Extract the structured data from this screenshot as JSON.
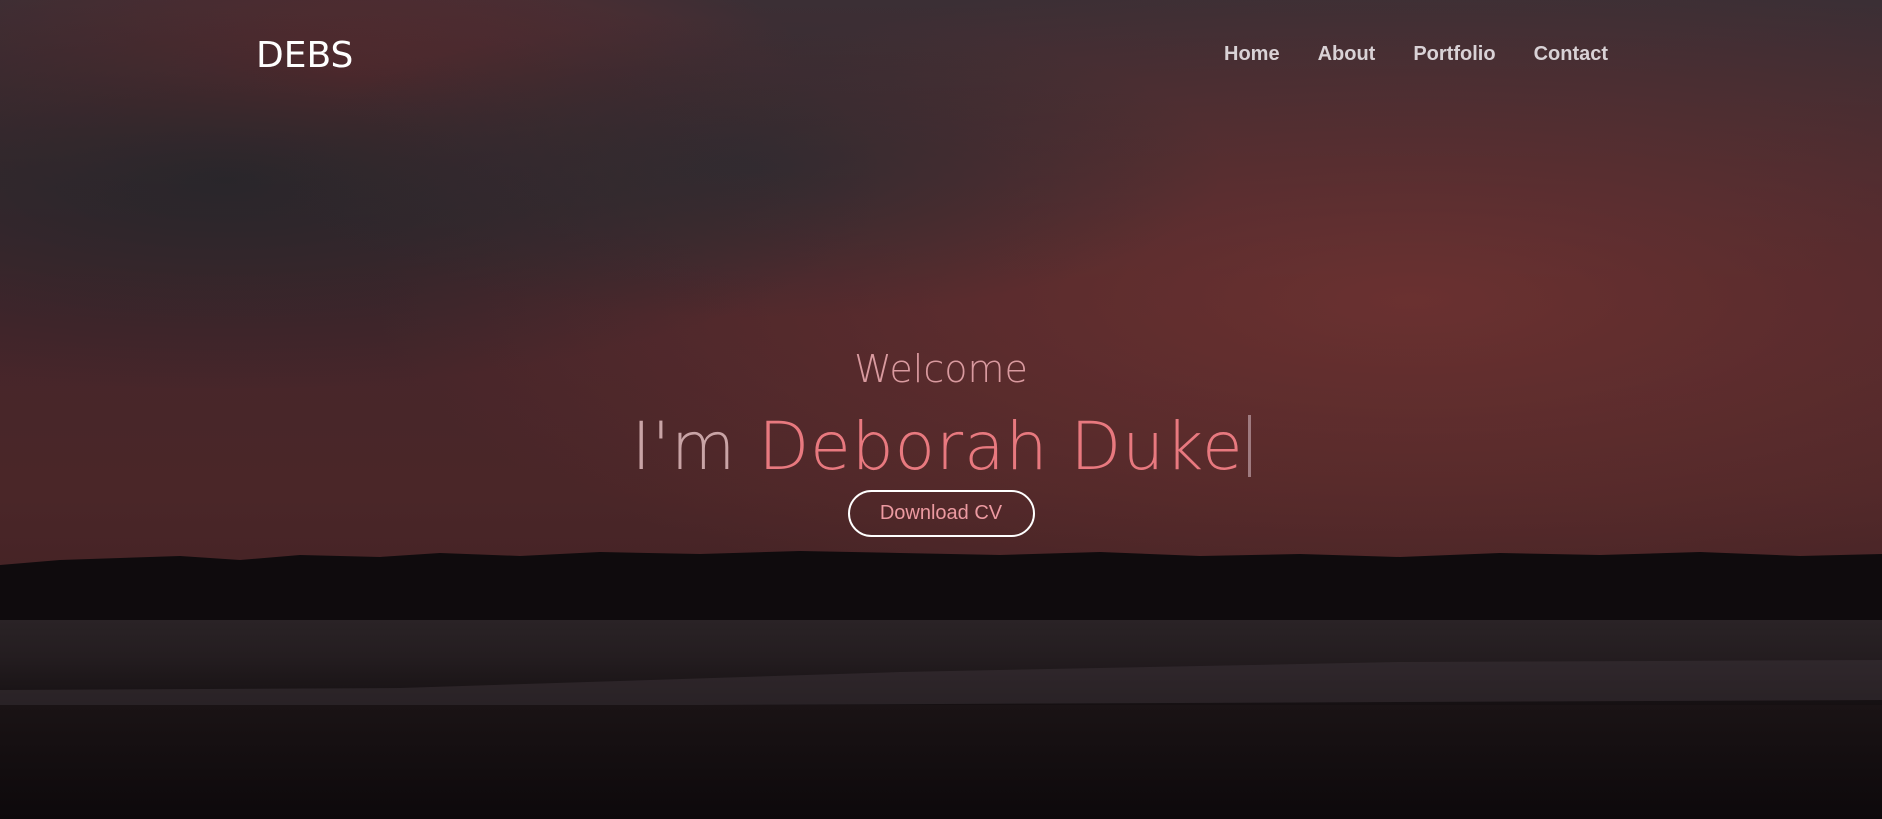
{
  "header": {
    "brand": "DEBS",
    "nav": [
      {
        "label": "Home"
      },
      {
        "label": "About"
      },
      {
        "label": "Portfolio"
      },
      {
        "label": "Contact"
      }
    ]
  },
  "hero": {
    "welcome": "Welcome",
    "prefix": "I'm ",
    "name": "Deborah Duke",
    "cta_label": "Download CV"
  },
  "colors": {
    "accent": "#e8797f",
    "nav_text": "#d9d2d6",
    "button_border": "#ffffff"
  }
}
